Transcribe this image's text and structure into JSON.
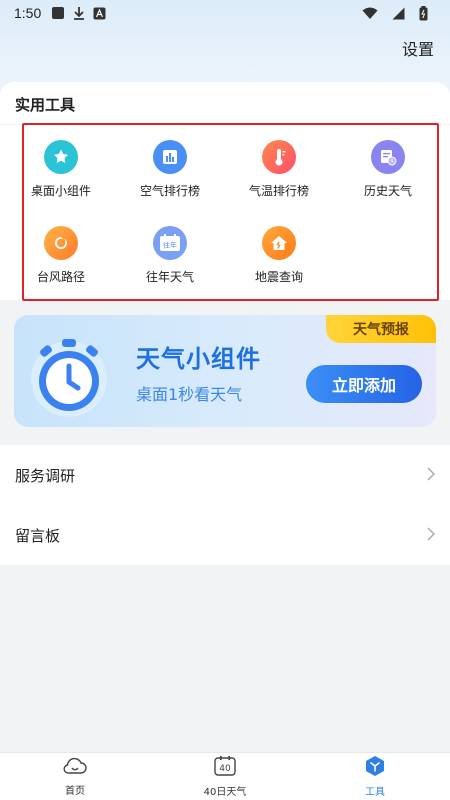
{
  "status": {
    "time": "1:50"
  },
  "header": {
    "settings_label": "设置"
  },
  "tools": {
    "title": "实用工具",
    "items": [
      {
        "label": "桌面小组件",
        "icon": "widget-icon",
        "color": "#2ac4d6"
      },
      {
        "label": "空气排行榜",
        "icon": "bar-chart-icon",
        "color": "#4a8ff5"
      },
      {
        "label": "气温排行榜",
        "icon": "thermometer-icon",
        "color": "#ff6a4d"
      },
      {
        "label": "历史天气",
        "icon": "history-calendar-icon",
        "color": "#8a84f0"
      },
      {
        "label": "台风路径",
        "icon": "typhoon-icon",
        "color": "#ff9a3c"
      },
      {
        "label": "往年天气",
        "icon": "past-years-calendar-icon",
        "color": "#7aa0f5",
        "badge": "往年"
      },
      {
        "label": "地震查询",
        "icon": "earthquake-house-icon",
        "color": "#ff8a2b"
      }
    ]
  },
  "banner": {
    "tag": "天气预报",
    "title": "天气小组件",
    "subtitle": "桌面1秒看天气",
    "button": "立即添加"
  },
  "menu": [
    {
      "label": "服务调研"
    },
    {
      "label": "留言板"
    }
  ],
  "tabbar": {
    "tabs": [
      {
        "label": "首页"
      },
      {
        "label": "40日天气",
        "icon_text": "40"
      },
      {
        "label": "工具"
      }
    ],
    "active": "工具"
  },
  "colors": {
    "accent": "#2f7fe8",
    "highlight_box": "#e0232a",
    "banner_tag": "#ffc107"
  }
}
